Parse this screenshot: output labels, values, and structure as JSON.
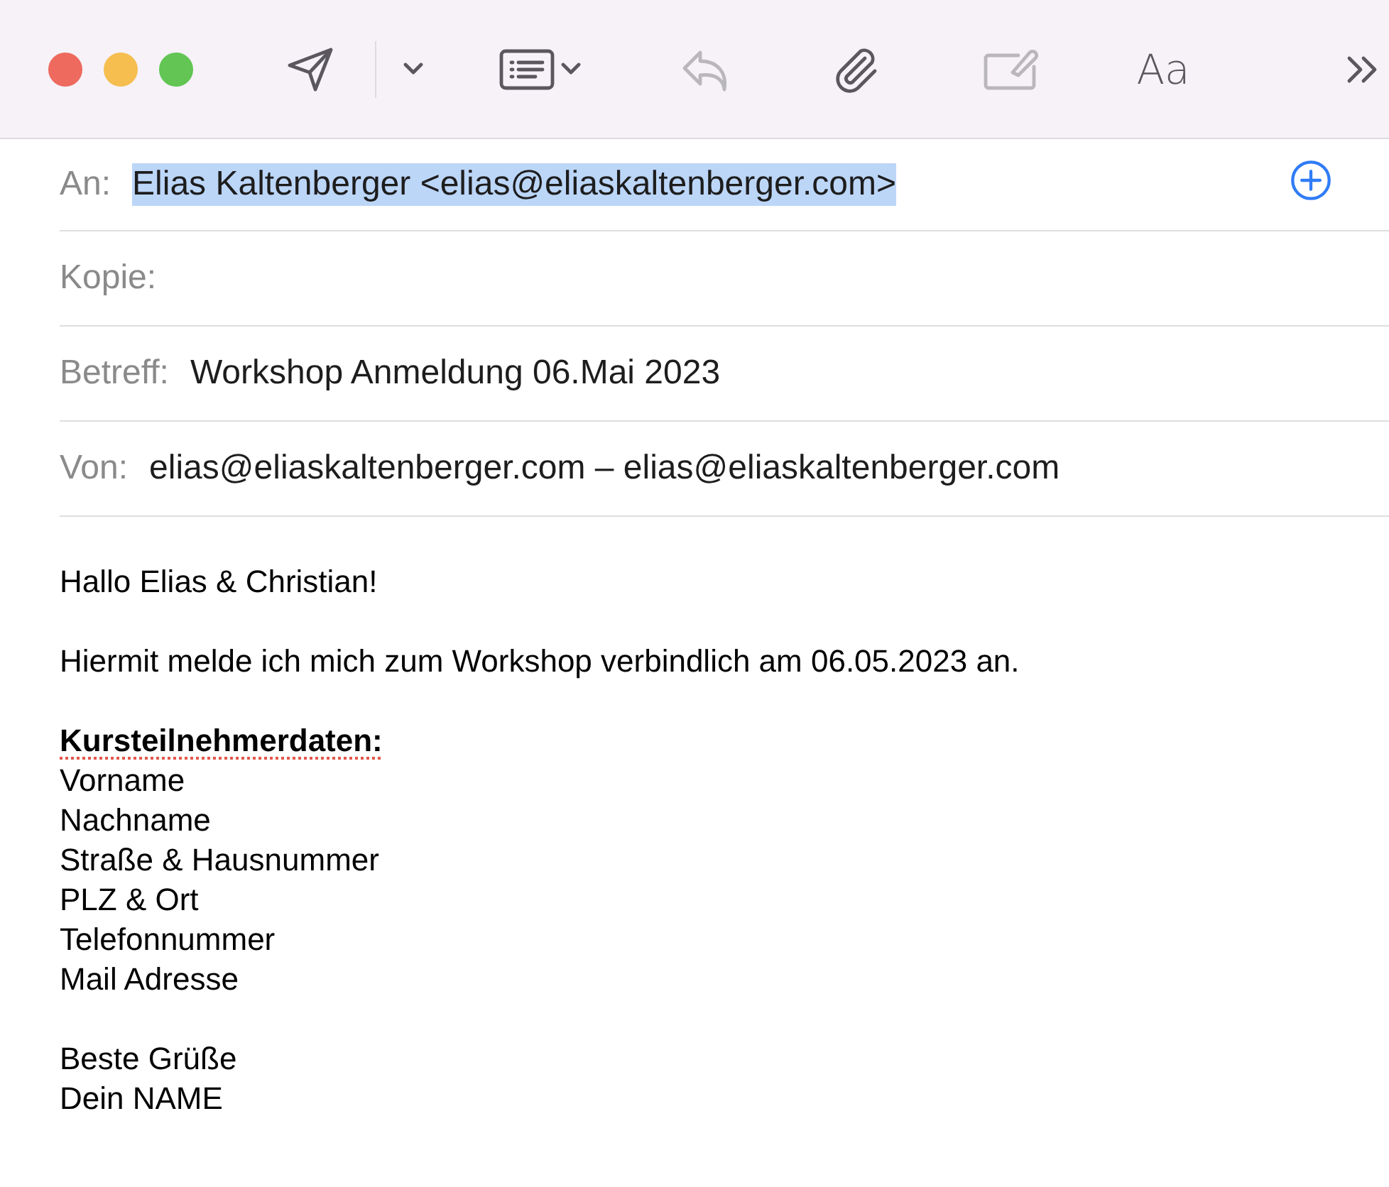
{
  "toolbar": {
    "window_controls": [
      {
        "color": "#ee6a5f"
      },
      {
        "color": "#f5be4f"
      },
      {
        "color": "#62c554"
      }
    ],
    "buttons": [
      {
        "kind": "send",
        "disabled": false
      },
      {
        "kind": "dropdown",
        "disabled": false
      },
      {
        "kind": "header-fields",
        "disabled": false
      },
      {
        "kind": "reply",
        "disabled": true
      },
      {
        "kind": "attach",
        "disabled": false
      },
      {
        "kind": "markup",
        "disabled": true
      },
      {
        "kind": "format",
        "label": "Aa",
        "disabled": false
      },
      {
        "kind": "more",
        "disabled": false
      }
    ]
  },
  "fields": [
    {
      "label": "An:",
      "value": "Elias Kaltenberger <elias@eliaskaltenberger.com>",
      "selected": true,
      "add_button": true
    },
    {
      "label": "Kopie:"
    },
    {
      "label": "Betreff:",
      "value": "Workshop Anmeldung 06.Mai 2023",
      "selected": false
    },
    {
      "label": "Von:",
      "value": "elias@eliaskaltenberger.com – elias@eliaskaltenberger.com",
      "selected": false
    }
  ],
  "body": [
    {
      "lines": [
        {
          "kind": "text",
          "text": "Hallo Elias & Christian!"
        }
      ]
    },
    {
      "lines": [
        {
          "kind": "text",
          "text": "Hiermit melde ich mich zum Workshop verbindlich am 06.05.2023 an."
        }
      ]
    },
    {
      "lines": [
        {
          "kind": "heading",
          "text": "Kursteilnehmerdaten:",
          "misspelled": true
        },
        {
          "kind": "text",
          "text": "Vorname"
        },
        {
          "kind": "text",
          "text": "Nachname"
        },
        {
          "kind": "text",
          "text": "Straße & Hausnummer"
        },
        {
          "kind": "text",
          "text": "PLZ & Ort"
        },
        {
          "kind": "text",
          "text": "Telefonnummer"
        },
        {
          "kind": "text",
          "text": "Mail Adresse"
        }
      ]
    },
    {
      "lines": [
        {
          "kind": "text",
          "text": "Beste Grüße"
        },
        {
          "kind": "text",
          "text": "Dein NAME"
        }
      ]
    }
  ]
}
